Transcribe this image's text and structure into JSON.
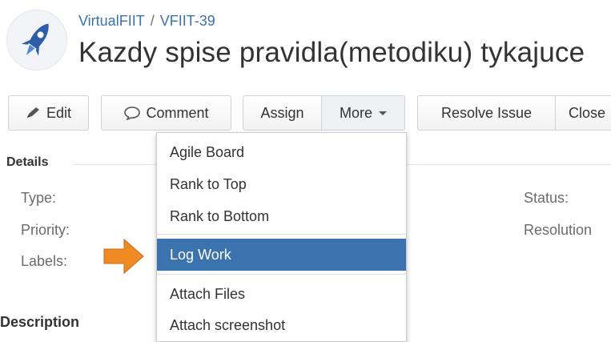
{
  "breadcrumb": {
    "project": "VirtualFIIT",
    "separator": "/",
    "issue_key": "VFIIT-39"
  },
  "issue": {
    "title": "Kazdy spise pravidla(metodiku) tykajuce"
  },
  "toolbar": {
    "edit_label": "Edit",
    "comment_label": "Comment",
    "assign_label": "Assign",
    "more_label": "More",
    "resolve_label": "Resolve Issue",
    "close_label": "Close"
  },
  "details": {
    "heading": "Details",
    "left_fields": [
      "Type:",
      "Priority:",
      "Labels:"
    ],
    "right_fields": [
      "Status:",
      "Resolution"
    ]
  },
  "more_menu": {
    "items": [
      "Agile Board",
      "Rank to Top",
      "Rank to Bottom",
      "Log Work",
      "Attach Files",
      "Attach screenshot"
    ],
    "selected": "Log Work"
  },
  "description": {
    "heading": "Description"
  },
  "colors": {
    "link": "#3b73af",
    "highlight": "#3b73af",
    "arrow": "#f08a24"
  },
  "icons": {
    "avatar": "rocket-icon",
    "edit": "pencil-icon",
    "comment": "speech-bubble-icon",
    "pointer": "arrow-right-icon"
  }
}
